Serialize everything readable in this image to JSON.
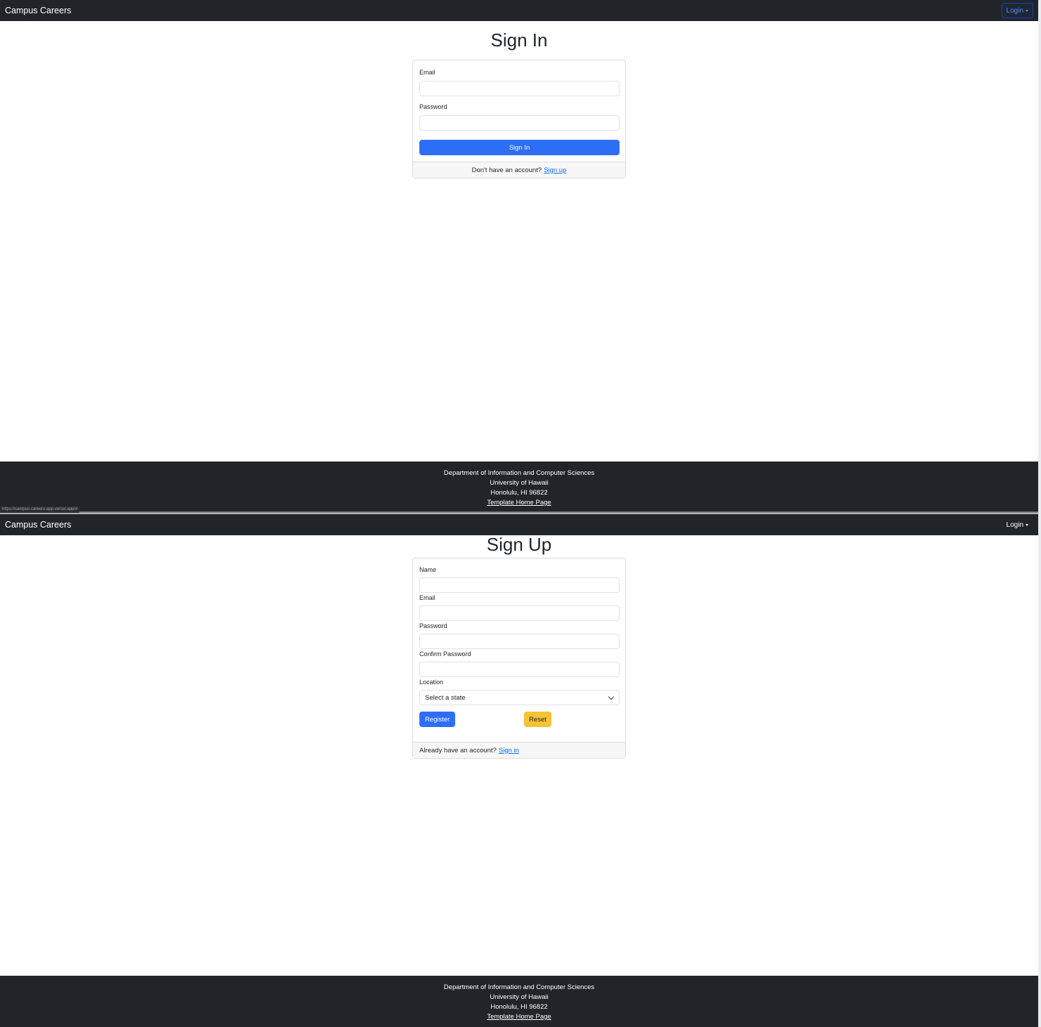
{
  "app": {
    "brand": "Campus Careers",
    "login_label": "Login"
  },
  "signin": {
    "title": "Sign In",
    "email_label": "Email",
    "email_value": "",
    "password_label": "Password",
    "password_value": "",
    "submit_label": "Sign In",
    "footer_text": "Don't have an account?",
    "footer_link": "Sign up"
  },
  "signup": {
    "title": "Sign Up",
    "name_label": "Name",
    "email_label": "Email",
    "password_label": "Password",
    "confirm_label": "Confirm Password",
    "location_label": "Location",
    "location_selected": "Select a state",
    "register_label": "Register",
    "reset_label": "Reset",
    "footer_text": "Already have an account?",
    "footer_link": "Sign in"
  },
  "footer": {
    "line1": "Department of Information and Computer Sciences",
    "line2": "University of Hawaii",
    "line3": "Honolulu, HI 96822",
    "link": "Template Home Page"
  },
  "status_url": "https://campus-careers-app.vercel.app/#",
  "colors": {
    "navbar": "#212529",
    "primary": "#2d6ef6",
    "warning": "#f5c333",
    "link": "#0d6efd"
  }
}
